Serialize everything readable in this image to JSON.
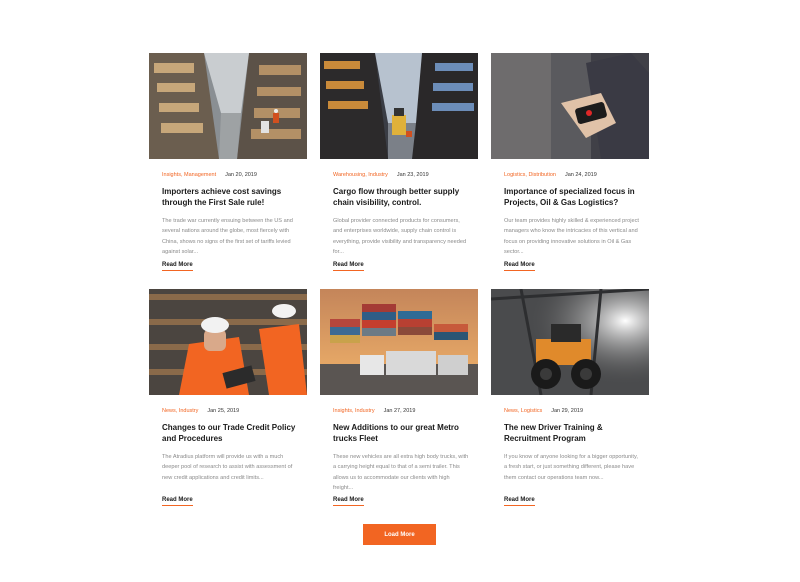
{
  "colors": {
    "accent": "#f26522",
    "title": "#1a1a1a",
    "excerpt": "#8a8a8a"
  },
  "posts": [
    {
      "image": "warehouse-aisle-forklift-photo",
      "categories": "Insights, Management",
      "date": "Jan 20, 2019",
      "title": "Importers achieve cost savings through the First Sale rule!",
      "excerpt": "The trade war currently ensuing between the US and several nations around the globe, most fiercely with China, shows no signs of the first set of tariffs levied against solar...",
      "read_more": "Read More"
    },
    {
      "image": "warehouse-racks-forklift-photo",
      "categories": "Warehousing, Industry",
      "date": "Jan 23, 2019",
      "title": "Cargo flow through better supply chain visibility, control.",
      "excerpt": "Global provider connected products for consumers, and enterprises worldwide, supply chain control is everything, provide visibility and transparency needed for...",
      "read_more": "Read More"
    },
    {
      "image": "barcode-scanner-photo",
      "categories": "Logistics, Distribution",
      "date": "Jan 24, 2019",
      "title": "Importance of specialized focus in Projects, Oil & Gas Logistics?",
      "excerpt": "Our team provides highly skilled & experienced project managers who know the intricacies of this vertical and focus on providing innovative solutions in Oil & Gas sector...",
      "read_more": "Read More"
    },
    {
      "image": "workers-hardhats-clipboard-photo",
      "categories": "News, Industry",
      "date": "Jan 25, 2019",
      "title": "Changes to our Trade Credit Policy and Procedures",
      "excerpt": "The Atradius platform will provide us with a much deeper pool of research to assist with assessment of new credit applications and credit limits...",
      "read_more": "Read More"
    },
    {
      "image": "containers-trucks-sunset-photo",
      "categories": "Insights,  Industry",
      "date": "Jan 27, 2019",
      "title": "New Additions to our great Metro trucks Fleet",
      "excerpt": "These new vehicles are all extra high body trucks, with a carrying height equal to that of a semi trailer. This allows us to accommodate our clients with high freight...",
      "read_more": "Read More"
    },
    {
      "image": "loader-vehicle-warehouse-photo",
      "categories": "News, Logistics",
      "date": "Jan 29, 2019",
      "title": "The new Driver Training & Recruitment Program",
      "excerpt": "If you know of anyone looking for a bigger opportunity, a fresh start, or just something different, please have them contact our operations team now...",
      "read_more": "Read More"
    }
  ],
  "load_more": "Load More"
}
